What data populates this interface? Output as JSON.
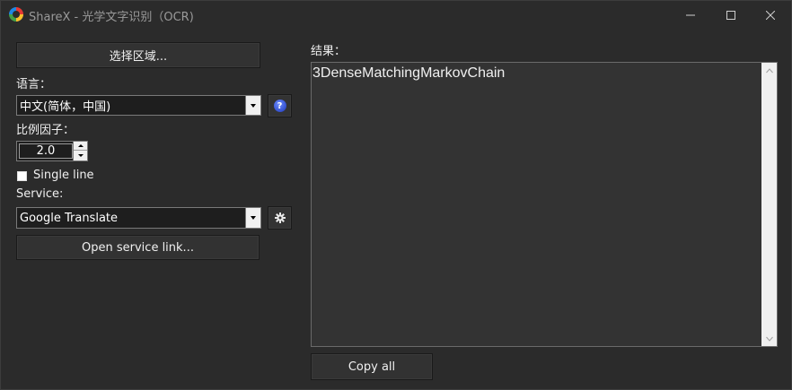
{
  "window": {
    "title": "ShareX - 光学文字识别（OCR)"
  },
  "left": {
    "select_region_label": "选择区域...",
    "language_label": "语言：",
    "language_value": "中文(简体，中国)",
    "help_icon_text": "?",
    "scale_label": "比例因子：",
    "scale_value": "2.0",
    "single_line_label": "Single line",
    "single_line_checked": false,
    "service_label": "Service:",
    "service_value": "Google Translate",
    "open_service_link_label": "Open service link..."
  },
  "right": {
    "result_label": "结果：",
    "result_text": "3DenseMatchingMarkovChain",
    "copy_all_label": "Copy all"
  },
  "colors": {
    "background": "#2b2b2b",
    "button_bg": "#323232",
    "text": "#f0f0f0",
    "help_icon": "#2a4fd8"
  }
}
